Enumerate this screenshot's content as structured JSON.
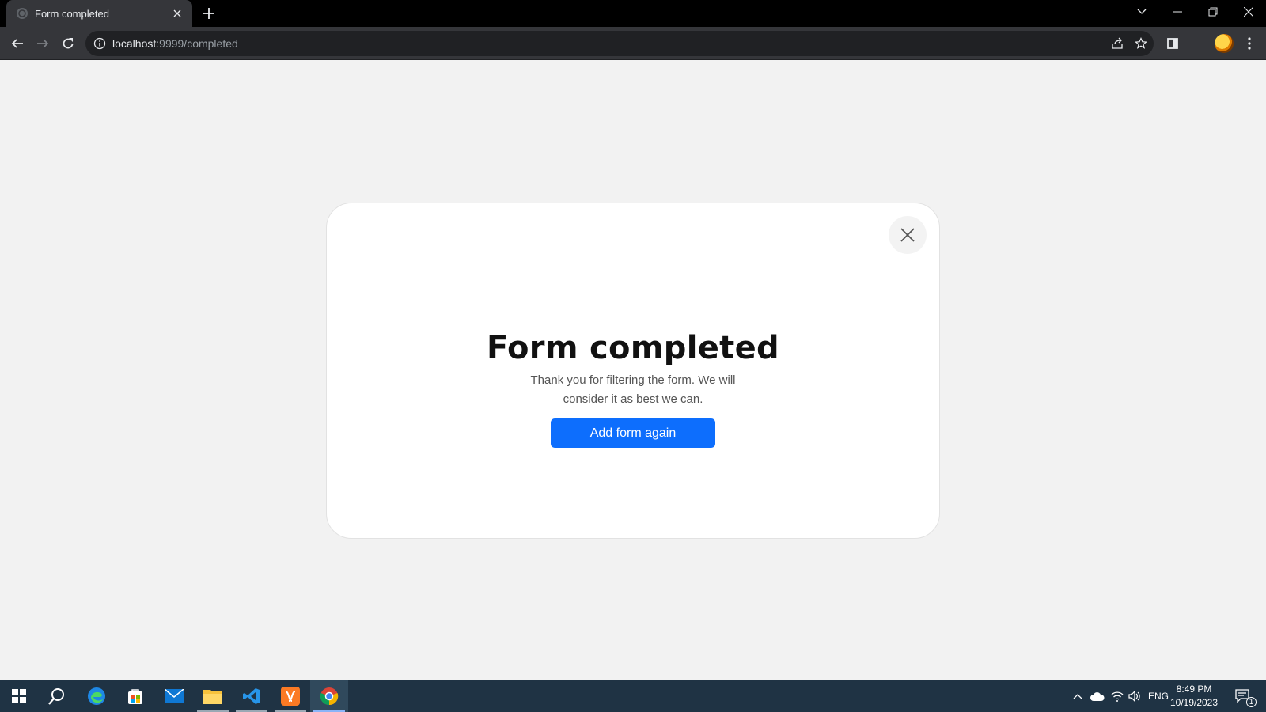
{
  "browser": {
    "tab_title": "Form completed",
    "url_host": "localhost",
    "url_path": ":9999/completed"
  },
  "page": {
    "title": "Form completed",
    "subtitle": "Thank you for filtering the form. We will consider it as best we can.",
    "button_label": "Add form again",
    "button_color": "#0d6efd"
  },
  "taskbar": {
    "apps": [
      "start-icon",
      "search-icon",
      "edge-icon",
      "store-icon",
      "mail-icon",
      "file-explorer-icon",
      "vscode-icon",
      "xampp-icon",
      "chrome-icon"
    ],
    "language": "ENG",
    "time": "8:49 PM",
    "date": "10/19/2023",
    "notification_count": "1"
  }
}
